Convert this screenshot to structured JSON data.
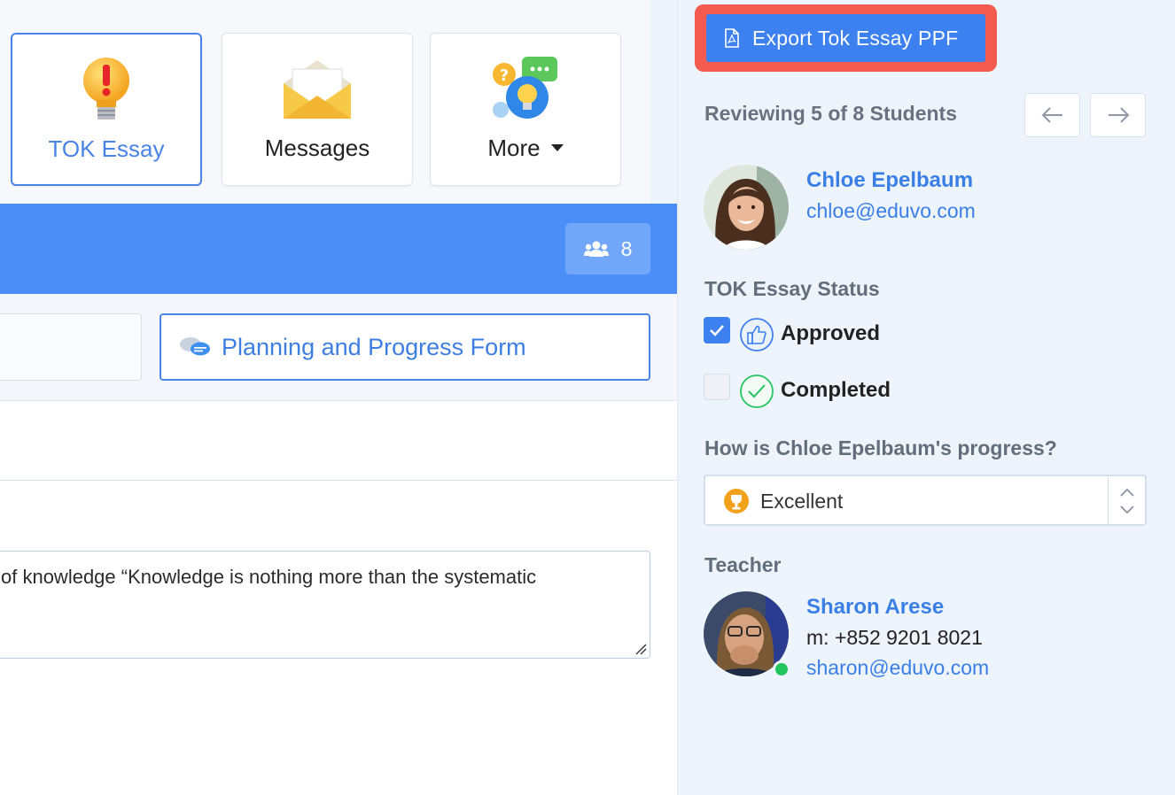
{
  "tiles": [
    {
      "label": "TOK Essay",
      "icon": "lightbulb-exclamation-icon",
      "active": true
    },
    {
      "label": "Messages",
      "icon": "envelope-icon",
      "active": false
    },
    {
      "label": "More",
      "icon": "idea-chat-icon",
      "active": false
    }
  ],
  "header_bar": {
    "member_count": "8",
    "member_icon": "users-icon"
  },
  "tabs": {
    "planning_label": "Planning and Progress Form",
    "planning_icon": "chat-bubbles-icon"
  },
  "essay": {
    "text": "of knowledge “Knowledge is nothing more than the systematic"
  },
  "sidebar": {
    "export_label": "Export Tok Essay PPF",
    "export_icon": "pdf-file-icon",
    "reviewing": "Reviewing 5 of 8 Students",
    "student": {
      "name": "Chloe Epelbaum",
      "email": "chloe@eduvo.com"
    },
    "status_title": "TOK Essay Status",
    "statuses": [
      {
        "label": "Approved",
        "checked": true,
        "icon": "thumbs-up-icon"
      },
      {
        "label": "Completed",
        "checked": false,
        "icon": "check-circle-icon"
      }
    ],
    "progress_question": "How is Chloe Epelbaum's progress?",
    "progress_value": "Excellent",
    "progress_icon": "trophy-icon",
    "teacher_title": "Teacher",
    "teacher": {
      "name": "Sharon Arese",
      "phone": "m: +852 9201 8021",
      "email": "sharon@eduvo.com",
      "online": true
    }
  },
  "colors": {
    "accent": "#4b8ef7",
    "highlight": "#f35b4f",
    "online": "#22c55e"
  }
}
